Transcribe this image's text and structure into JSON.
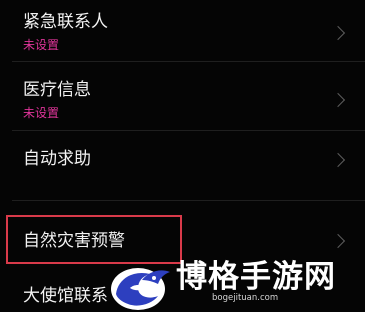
{
  "settings": {
    "items": [
      {
        "label": "紧急联系人",
        "status": "未设置"
      },
      {
        "label": "医疗信息",
        "status": "未设置"
      },
      {
        "label": "自动求助"
      },
      {
        "label": "自然灾害预警"
      },
      {
        "label": "大使馆联系"
      }
    ]
  },
  "watermark": {
    "name": "博格手游网",
    "url": "bogejituan.com"
  },
  "colors": {
    "background": "#050505",
    "status_text": "#e0359a",
    "highlight_box": "#d93a4a",
    "chevron": "#5d5d5d",
    "watermark_logo": "#2d3fbf"
  },
  "icons": [
    "chevron-right-icon",
    "bird-logo-icon"
  ]
}
